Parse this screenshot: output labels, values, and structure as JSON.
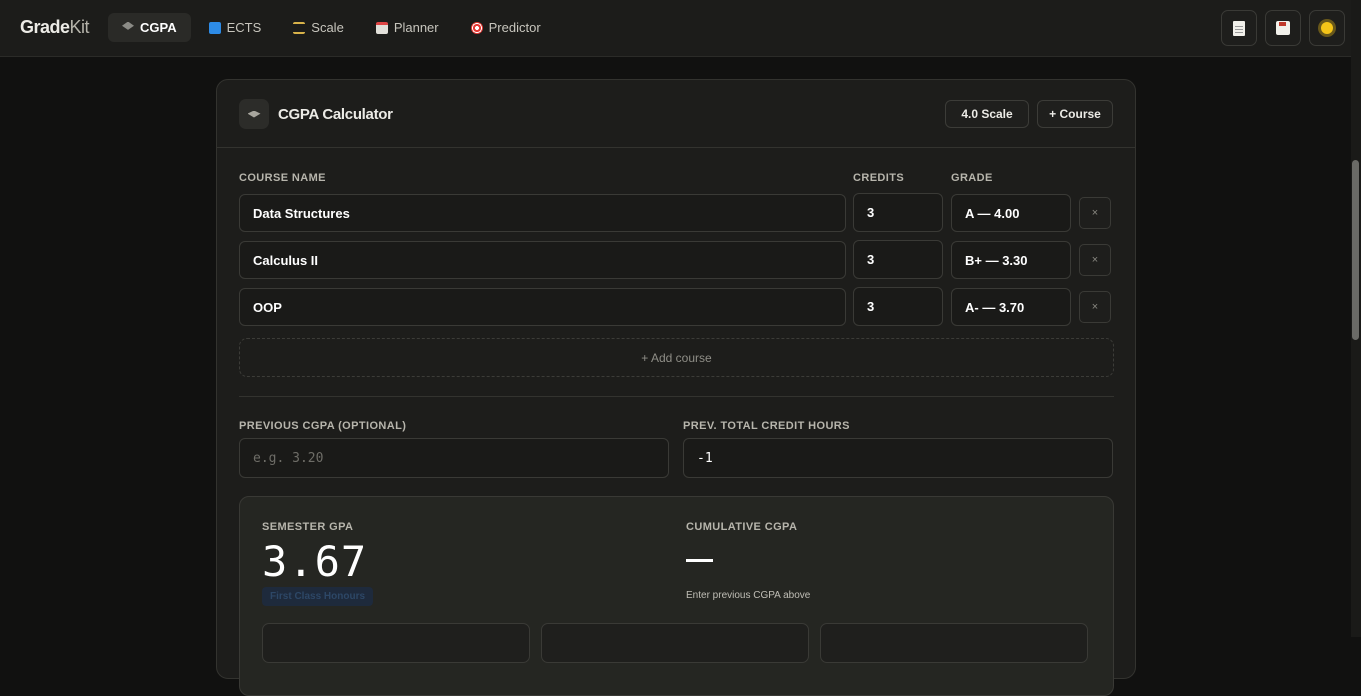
{
  "brand": {
    "primary": "Grade",
    "secondary": "Kit"
  },
  "nav": [
    {
      "label": "CGPA",
      "icon": "graduation-cap-icon",
      "active": true
    },
    {
      "label": "ECTS",
      "icon": "refresh-icon",
      "active": false
    },
    {
      "label": "Scale",
      "icon": "scale-icon",
      "active": false
    },
    {
      "label": "Planner",
      "icon": "calendar-icon",
      "active": false
    },
    {
      "label": "Predictor",
      "icon": "target-icon",
      "active": false
    }
  ],
  "toolbar": {
    "icons": [
      "document-icon",
      "save-icon",
      "sun-icon"
    ]
  },
  "card": {
    "title": "CGPA Calculator",
    "scale_button": "4.0 Scale",
    "add_course_button": "+ Course"
  },
  "table": {
    "headers": {
      "course": "COURSE NAME",
      "credits": "CREDITS",
      "grade": "GRADE"
    },
    "rows": [
      {
        "name": "Data Structures",
        "credits": "3",
        "grade": "A — 4.00"
      },
      {
        "name": "Calculus II",
        "credits": "3",
        "grade": "B+ — 3.30"
      },
      {
        "name": "OOP",
        "credits": "3",
        "grade": "A- — 3.70"
      }
    ],
    "remove_label": "×",
    "add_course_label": "+ Add course"
  },
  "previous": {
    "cgpa_label": "PREVIOUS CGPA (OPTIONAL)",
    "cgpa_placeholder": "e.g. 3.20",
    "hours_label": "PREV. TOTAL CREDIT HOURS",
    "hours_value": "-1"
  },
  "results": {
    "semester_label": "SEMESTER GPA",
    "semester_value": "3.67",
    "badge": "First Class Honours",
    "cumulative_label": "CUMULATIVE CGPA",
    "cumulative_value": "—",
    "cumulative_hint": "Enter previous CGPA above"
  },
  "colors": {
    "background": "#111110",
    "surface": "#1d1d1b",
    "badge_text": "#2d4766",
    "accent_sun": "#f5c518"
  }
}
